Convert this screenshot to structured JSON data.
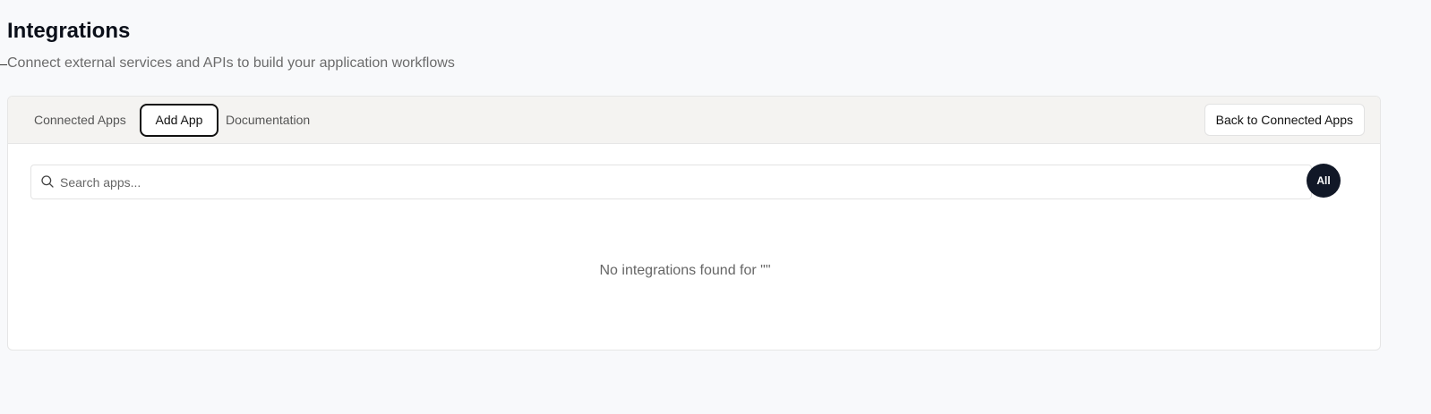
{
  "header": {
    "title": "Integrations",
    "subtitle": "Connect external services and APIs to build your application workflows"
  },
  "tabs": [
    {
      "label": "Connected Apps",
      "active": false
    },
    {
      "label": "Add App",
      "active": true
    },
    {
      "label": "Documentation",
      "active": false
    }
  ],
  "actions": {
    "back_label": "Back to Connected Apps"
  },
  "search": {
    "placeholder": "Search apps...",
    "value": "",
    "icon": "search-icon"
  },
  "filter": {
    "label": "All"
  },
  "empty_state": {
    "message": "No integrations found for \"\""
  },
  "colors": {
    "accent": "#111827",
    "header_bg": "#f4f3f1",
    "page_bg": "#f8f9fb"
  }
}
